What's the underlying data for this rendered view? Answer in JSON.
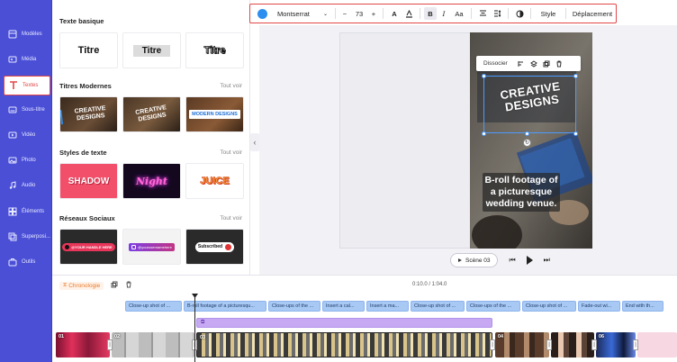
{
  "sidebar": {
    "items": [
      {
        "label": "Modèles",
        "icon": "template-icon"
      },
      {
        "label": "Média",
        "icon": "media-icon"
      },
      {
        "label": "Textes",
        "icon": "text-icon"
      },
      {
        "label": "Sous-titre",
        "icon": "subtitle-icon"
      },
      {
        "label": "Vidéo",
        "icon": "video-icon"
      },
      {
        "label": "Photo",
        "icon": "photo-icon"
      },
      {
        "label": "Audio",
        "icon": "audio-icon"
      },
      {
        "label": "Éléments",
        "icon": "elements-icon"
      },
      {
        "label": "Superposi...",
        "icon": "overlay-icon"
      },
      {
        "label": "Outils",
        "icon": "tools-icon"
      }
    ],
    "active": "Textes"
  },
  "panel": {
    "basic": {
      "title": "Texte basique",
      "cards": [
        "Titre",
        "Titre",
        "Titre"
      ]
    },
    "modern": {
      "title": "Titres Modernes",
      "more": "Tout voir",
      "cards": [
        "CREATIVE DESIGNS",
        "CREATIVE DESIGNS",
        "MODERN DESIGNS"
      ]
    },
    "styles": {
      "title": "Styles de texte",
      "more": "Tout voir",
      "cards": [
        "SHADOW",
        "Night",
        "JUICE"
      ]
    },
    "social": {
      "title": "Réseaux Sociaux",
      "more": "Tout voir",
      "cards": [
        "@YOUR HANDLE HERE",
        "@yourusernamehere",
        "Subscribed"
      ]
    }
  },
  "toolbar": {
    "color": "#2d8ef0",
    "font": "Montserrat",
    "size": "73",
    "minus": "−",
    "plus": "+",
    "text_color_label": "A",
    "case_label": "Aa",
    "style": "Style",
    "move": "Déplacement"
  },
  "canvas": {
    "context_menu": {
      "label": "Dissocier"
    },
    "creative_text": "CREATIVE DESIGNS",
    "broll_text": "B-roll footage of a picturesque wedding venue.",
    "scene_label": "Scène 03"
  },
  "timeline": {
    "label": "Chronologie",
    "time": "0:10.0 / 1:04.0",
    "captions": [
      "Close-up shot of ...",
      "B-roll footage of a picturesqu...",
      "Close-ups of the ...",
      "Insert a cal...",
      "Insert a ma...",
      "Close-up shot of ...",
      "Close-ups of the ...",
      "Close-up shot of ...",
      "Fade-out wi...",
      "End with th..."
    ],
    "clips": [
      "01",
      "02",
      "03",
      "04",
      "05",
      "06"
    ]
  },
  "colors": {
    "rail": "#4a4fd6",
    "accent": "#e24747",
    "caption": "#a9c9f5",
    "purple": "#c6a9f2"
  }
}
